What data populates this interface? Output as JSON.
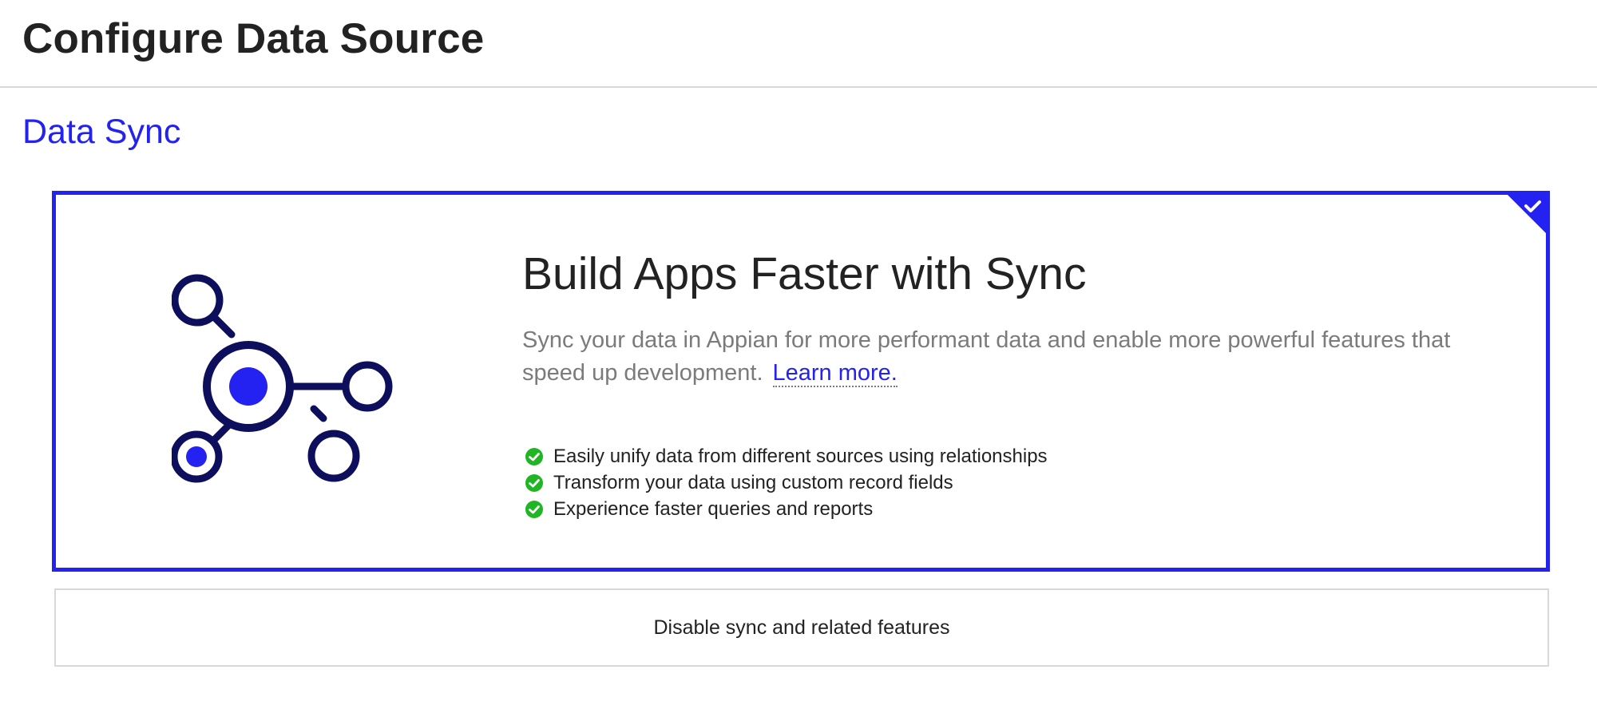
{
  "header": {
    "title": "Configure Data Source"
  },
  "section": {
    "title": "Data Sync"
  },
  "sync_card": {
    "selected": true,
    "heading": "Build Apps Faster with Sync",
    "description": "Sync your data in Appian for more performant data and enable more powerful features that speed up development.",
    "learn_more_label": "Learn more.",
    "features": [
      "Easily unify data from different sources using relationships",
      "Transform your data using custom record fields",
      "Experience faster queries and reports"
    ],
    "illustration_icon": "data-network-icon",
    "check_icon": "green-check-circle-icon"
  },
  "disable_option": {
    "label": "Disable sync and related features"
  },
  "colors": {
    "accent": "#2322F0",
    "navy": "#0E0F5C",
    "success": "#1FB523",
    "muted_text": "#7B7B7B",
    "border": "#D8D8D8"
  }
}
